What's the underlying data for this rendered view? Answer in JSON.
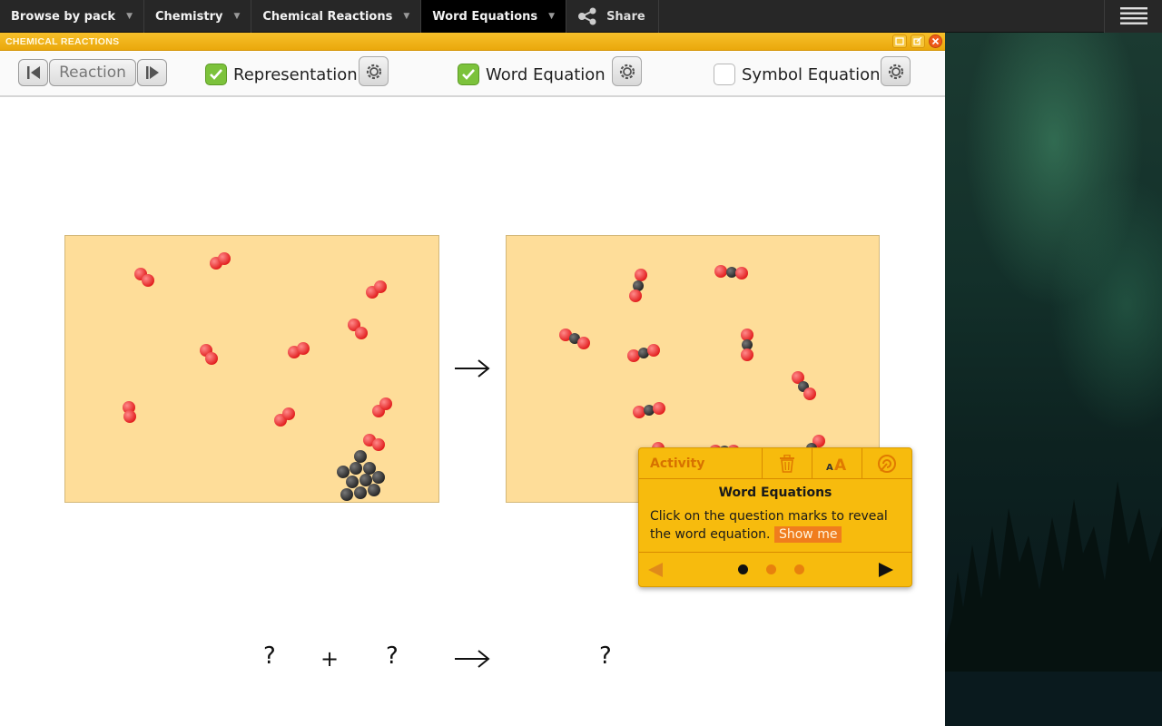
{
  "topnav": {
    "items": [
      {
        "label": "Browse by pack"
      },
      {
        "label": "Chemistry"
      },
      {
        "label": "Chemical Reactions"
      },
      {
        "label": "Word Equations"
      }
    ],
    "share_label": "Share"
  },
  "window": {
    "title": "CHEMICAL REACTIONS"
  },
  "toolbar": {
    "reaction_label": "Reaction",
    "options": [
      {
        "label": "Representation",
        "checked": true
      },
      {
        "label": "Word Equation",
        "checked": true
      },
      {
        "label": "Symbol Equation",
        "checked": false
      }
    ]
  },
  "equation": {
    "reactant_1": "?",
    "plus": "+",
    "reactant_2": "?",
    "product": "?"
  },
  "activity": {
    "tab_label": "Activity",
    "heading": "Word Equations",
    "body": "Click on the question marks to reveal the word equation.",
    "show_me": "Show me",
    "page": 1,
    "pages": 3
  },
  "colors": {
    "accent": "#f7bb0d",
    "panel_bg": "#fedd99",
    "oxygen": "#f03030",
    "carbon": "#3a3a3a",
    "check_green": "#7cc23b"
  }
}
